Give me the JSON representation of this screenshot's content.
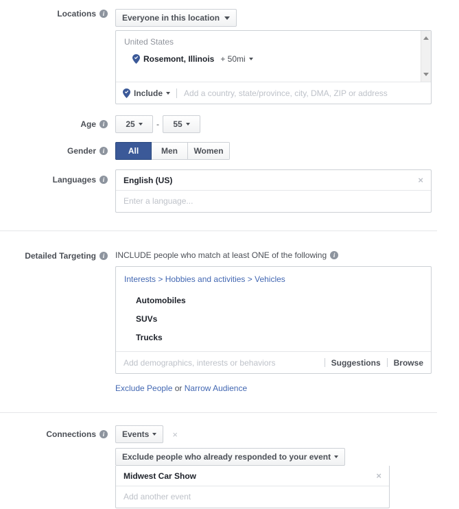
{
  "locations": {
    "label": "Locations",
    "audience_scope": "Everyone in this location",
    "country": "United States",
    "place": "Rosemont, Illinois",
    "radius": "+ 50mi",
    "include_label": "Include",
    "input_placeholder": "Add a country, state/province, city, DMA, ZIP or address"
  },
  "age": {
    "label": "Age",
    "min": "25",
    "separator": "-",
    "max": "55"
  },
  "gender": {
    "label": "Gender",
    "options": [
      {
        "label": "All",
        "selected": true
      },
      {
        "label": "Men",
        "selected": false
      },
      {
        "label": "Women",
        "selected": false
      }
    ]
  },
  "languages": {
    "label": "Languages",
    "selected": "English (US)",
    "remove_glyph": "×",
    "input_placeholder": "Enter a language..."
  },
  "detailed_targeting": {
    "label": "Detailed Targeting",
    "headline": "INCLUDE people who match at least ONE of the following",
    "breadcrumb": "Interests > Hobbies and activities > Vehicles",
    "items": [
      "Automobiles",
      "SUVs",
      "Trucks"
    ],
    "input_placeholder": "Add demographics, interests or behaviors",
    "suggestions_label": "Suggestions",
    "browse_label": "Browse",
    "exclude_link": "Exclude People",
    "or_text": " or ",
    "narrow_link": "Narrow Audience"
  },
  "connections": {
    "label": "Connections",
    "type": "Events",
    "remove_glyph": "×",
    "rule": "Exclude people who already responded to your event",
    "event_name": "Midwest Car Show",
    "event_remove_glyph": "×",
    "add_placeholder": "Add another event"
  },
  "colors": {
    "accent_blue": "#3b5998",
    "link_blue": "#4267b2",
    "pin_blue": "#3b5998",
    "border": "#ccd0d5",
    "label_gray": "#4b4f56",
    "placeholder_gray": "#bec2c9"
  }
}
